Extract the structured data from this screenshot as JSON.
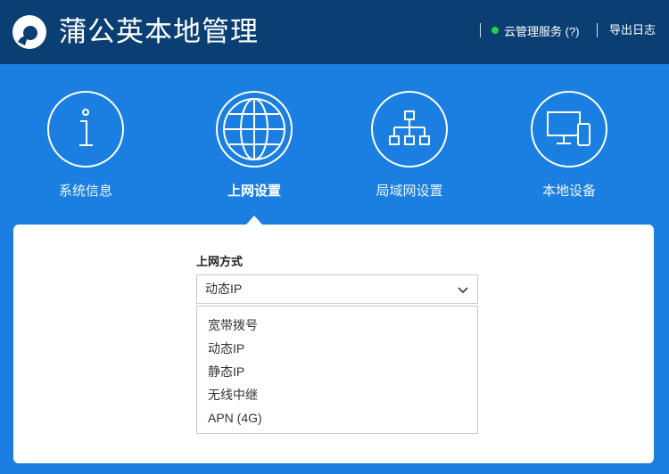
{
  "header": {
    "title": "蒲公英本地管理",
    "cloud_service": "云管理服务 (?)",
    "cloud_status_color": "#28d143",
    "export_log": "导出日志"
  },
  "nav": {
    "items": [
      {
        "label": "系统信息",
        "icon": "info-icon"
      },
      {
        "label": "上网设置",
        "icon": "globe-icon",
        "active": true
      },
      {
        "label": "局域网设置",
        "icon": "network-icon"
      },
      {
        "label": "本地设备",
        "icon": "devices-icon"
      }
    ]
  },
  "form": {
    "label": "上网方式",
    "selected": "动态IP",
    "options": [
      "宽带拨号",
      "动态IP",
      "静态IP",
      "无线中继",
      "APN (4G)"
    ]
  },
  "colors": {
    "topbar": "#0b3f74",
    "background": "#1a7fe0",
    "panel": "#ffffff"
  }
}
